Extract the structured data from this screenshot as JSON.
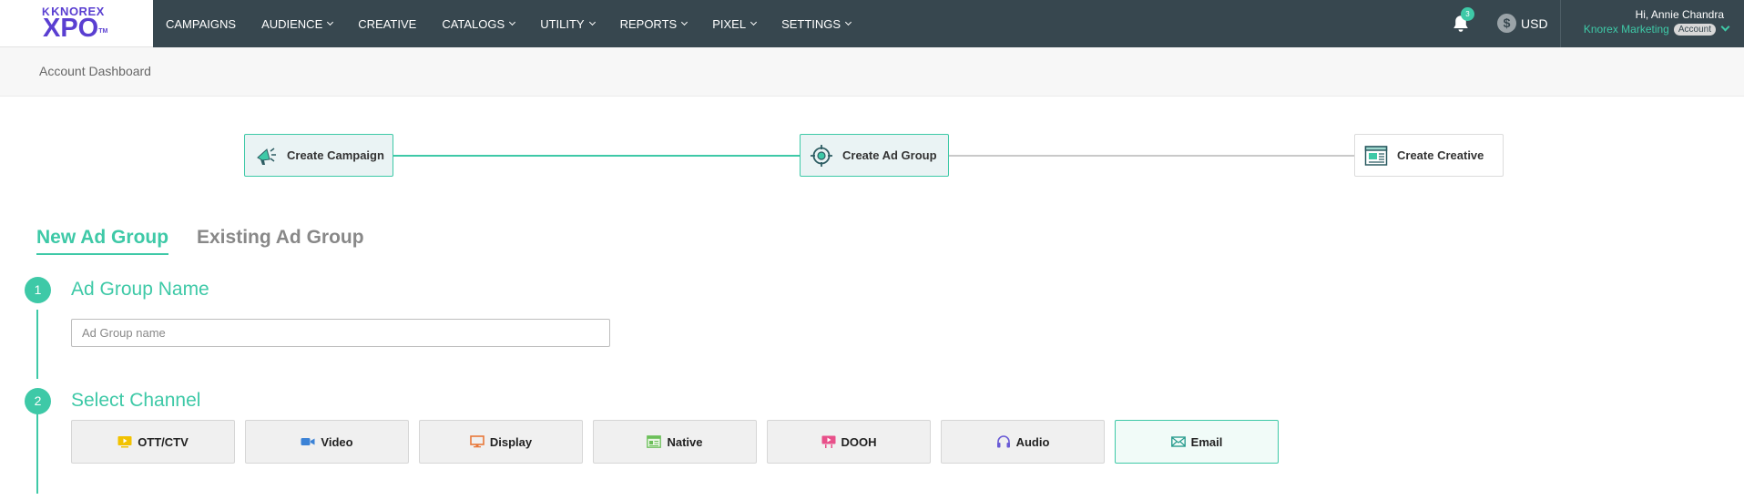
{
  "logo": {
    "small": "KNOREX",
    "big": "XPO",
    "tm": "TM"
  },
  "nav": {
    "items": [
      {
        "label": "CAMPAIGNS",
        "dropdown": false
      },
      {
        "label": "AUDIENCE",
        "dropdown": true
      },
      {
        "label": "CREATIVE",
        "dropdown": false
      },
      {
        "label": "CATALOGS",
        "dropdown": true
      },
      {
        "label": "UTILITY",
        "dropdown": true
      },
      {
        "label": "REPORTS",
        "dropdown": true
      },
      {
        "label": "PIXEL",
        "dropdown": true
      },
      {
        "label": "SETTINGS",
        "dropdown": true
      }
    ]
  },
  "notifications": {
    "count": "3"
  },
  "currency": {
    "symbol": "$",
    "code": "USD"
  },
  "user": {
    "greeting": "Hi, Annie Chandra",
    "account_name": "Knorex Marketing",
    "account_badge": "Account"
  },
  "breadcrumb": {
    "text": "Account Dashboard"
  },
  "steps": [
    {
      "label": "Create Campaign",
      "state": "done"
    },
    {
      "label": "Create Ad Group",
      "state": "active"
    },
    {
      "label": "Create Creative",
      "state": "pending"
    }
  ],
  "tabs": {
    "new": "New Ad Group",
    "existing": "Existing Ad Group"
  },
  "section1": {
    "number": "1",
    "title": "Ad Group Name",
    "input_value": "",
    "input_placeholder": "Ad Group name"
  },
  "section2": {
    "number": "2",
    "title": "Select Channel",
    "channels": [
      {
        "label": "OTT/CTV",
        "icon": "tv-icon",
        "color": "#f2c200",
        "selected": false
      },
      {
        "label": "Video",
        "icon": "video-camera-icon",
        "color": "#3b82d6",
        "selected": false
      },
      {
        "label": "Display",
        "icon": "monitor-icon",
        "color": "#e8783a",
        "selected": false
      },
      {
        "label": "Native",
        "icon": "article-icon",
        "color": "#6bbf59",
        "selected": false
      },
      {
        "label": "DOOH",
        "icon": "billboard-icon",
        "color": "#e8508a",
        "selected": false
      },
      {
        "label": "Audio",
        "icon": "headphones-icon",
        "color": "#6a5bd6",
        "selected": false
      },
      {
        "label": "Email",
        "icon": "envelope-icon",
        "color": "#2a9d8f",
        "selected": true
      }
    ]
  },
  "colors": {
    "accent": "#3ec9a7",
    "topbar": "#37474f",
    "brand": "#5a3fd1"
  }
}
